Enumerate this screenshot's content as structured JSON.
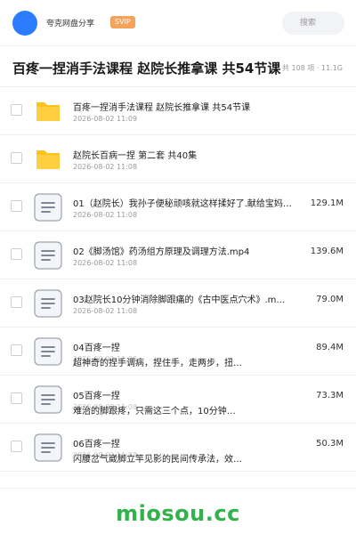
{
  "header": {
    "user_name": "夸克网盘分享",
    "badge": "SVIP",
    "search_placeholder": "搜索"
  },
  "share": {
    "title": "百疼一捏消手法课程 赵院长推拿课 共54节课",
    "meta": "共 108 项 · 11.1G"
  },
  "files": [
    {
      "type": "folder",
      "name": "百疼一捏消手法课程 赵院长推拿课 共54节课",
      "date": "2026-08-02 11:09",
      "size": ""
    },
    {
      "type": "folder",
      "name": "赵院长百病一捏 第二套 共40集",
      "date": "2026-08-02 11:08",
      "size": ""
    },
    {
      "type": "file",
      "name": "01（赵院长）我孙子便秘顽咳就这样揉好了.献给宝妈…",
      "date": "2026-08-02 11:08",
      "size": "129.1M"
    },
    {
      "type": "file",
      "name": "02《脚汤馆》药汤组方原理及调理方法.mp4",
      "date": "2026-08-02 11:08",
      "size": "139.6M"
    },
    {
      "type": "file",
      "name": "03赵院长10分钟消除脚跟痛的《古中医点穴术》.m…",
      "date": "2026-08-02 11:08",
      "size": "79.0M"
    },
    {
      "type": "file",
      "name": "04百疼一捏",
      "desc": "超神奇的捏手调病，捏住手，走两步，扭…",
      "date": "2026-08-02 11:08",
      "size": "89.4M"
    },
    {
      "type": "file",
      "name": "05百疼一捏",
      "desc": "难治的脚跟疼，只需这三个点，10分钟…",
      "date": "2026-08-02 11:08",
      "size": "73.3M"
    },
    {
      "type": "file",
      "name": "06百疼一捏",
      "desc": "闪腰岔气崴脚立竿见影的民间传承法，效…",
      "date": "2026-08-02 11:08",
      "size": "50.3M"
    }
  ],
  "footer": {
    "watermark": "miosou.cc"
  },
  "colors": {
    "brand_blue": "#2b7cff",
    "svip_orange": "#f5a35b",
    "folder_yellow": "#ffc21a",
    "watermark_green": "#2fb34a"
  }
}
